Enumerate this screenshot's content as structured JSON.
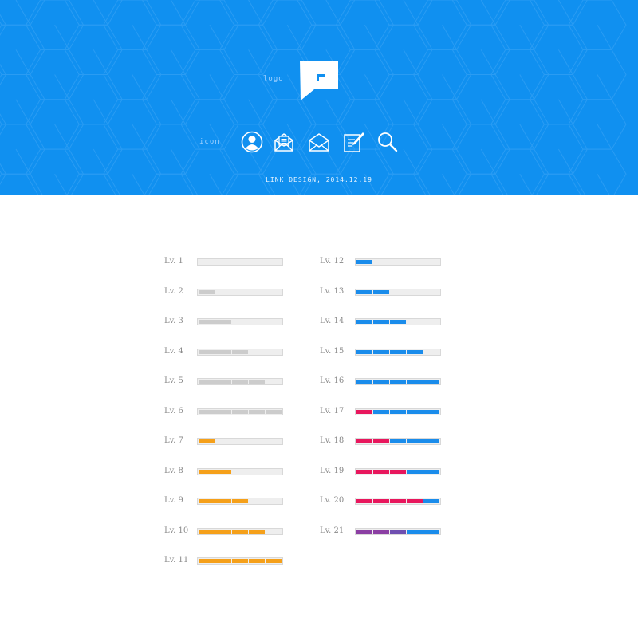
{
  "header": {
    "logo_label": "logo",
    "icon_label": "icon",
    "icons": [
      "user-icon",
      "mail-open-icon",
      "mail-icon",
      "edit-icon",
      "search-icon"
    ],
    "credit": "LINK DESIGN, 2014.12.19",
    "background_color": "#1090f0"
  },
  "colors": {
    "gray": "#cccccc",
    "orange": "#f5a01a",
    "blue": "#1a8ceb",
    "red": "#e8175d",
    "purple": "#8b3fa3",
    "violet": "#6f4fb0",
    "track": "#eeeeee"
  },
  "levels": [
    {
      "label": "Lv. 1",
      "segments": []
    },
    {
      "label": "Lv. 2",
      "segments": [
        "gray"
      ]
    },
    {
      "label": "Lv. 3",
      "segments": [
        "gray",
        "gray"
      ]
    },
    {
      "label": "Lv. 4",
      "segments": [
        "gray",
        "gray",
        "gray"
      ]
    },
    {
      "label": "Lv. 5",
      "segments": [
        "gray",
        "gray",
        "gray",
        "gray"
      ]
    },
    {
      "label": "Lv. 6",
      "segments": [
        "gray",
        "gray",
        "gray",
        "gray",
        "gray"
      ]
    },
    {
      "label": "Lv. 7",
      "segments": [
        "orange"
      ]
    },
    {
      "label": "Lv. 8",
      "segments": [
        "orange",
        "orange"
      ]
    },
    {
      "label": "Lv. 9",
      "segments": [
        "orange",
        "orange",
        "orange"
      ]
    },
    {
      "label": "Lv. 10",
      "segments": [
        "orange",
        "orange",
        "orange",
        "orange"
      ]
    },
    {
      "label": "Lv. 11",
      "segments": [
        "orange",
        "orange",
        "orange",
        "orange",
        "orange"
      ]
    },
    {
      "label": "Lv. 12",
      "segments": [
        "blue"
      ]
    },
    {
      "label": "Lv. 13",
      "segments": [
        "blue",
        "blue"
      ]
    },
    {
      "label": "Lv. 14",
      "segments": [
        "blue",
        "blue",
        "blue"
      ]
    },
    {
      "label": "Lv. 15",
      "segments": [
        "blue",
        "blue",
        "blue",
        "blue"
      ]
    },
    {
      "label": "Lv. 16",
      "segments": [
        "blue",
        "blue",
        "blue",
        "blue",
        "blue"
      ]
    },
    {
      "label": "Lv. 17",
      "segments": [
        "red",
        "blue",
        "blue",
        "blue",
        "blue"
      ]
    },
    {
      "label": "Lv. 18",
      "segments": [
        "red",
        "red",
        "blue",
        "blue",
        "blue"
      ]
    },
    {
      "label": "Lv. 19",
      "segments": [
        "red",
        "red",
        "red",
        "blue",
        "blue"
      ]
    },
    {
      "label": "Lv. 20",
      "segments": [
        "red",
        "red",
        "red",
        "red",
        "blue"
      ]
    },
    {
      "label": "Lv. 21",
      "segments": [
        "purple",
        "purple",
        "violet",
        "blue",
        "blue"
      ]
    }
  ]
}
